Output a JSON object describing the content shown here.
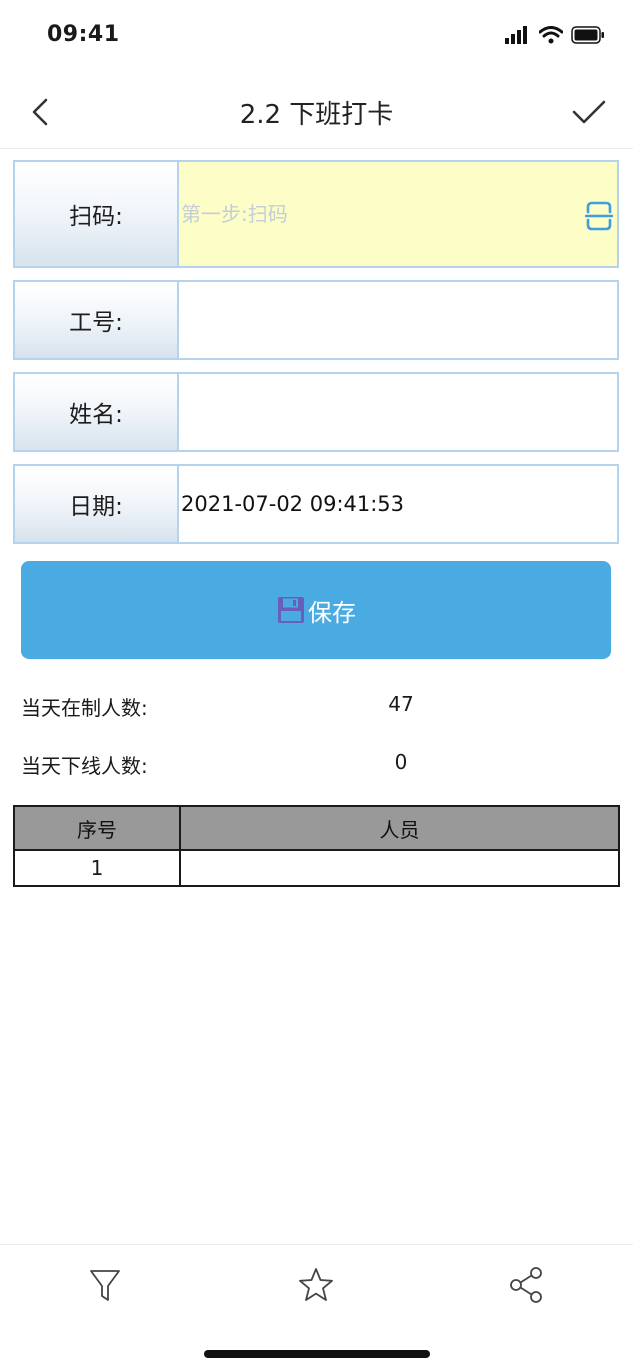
{
  "status_bar": {
    "time": "09:41"
  },
  "nav": {
    "title": "2.2 下班打卡"
  },
  "form": {
    "scan": {
      "label": "扫码:",
      "value": "",
      "placeholder": "第一步:扫码"
    },
    "employee_no": {
      "label": "工号:",
      "value": ""
    },
    "name": {
      "label": "姓名:",
      "value": ""
    },
    "date": {
      "label": "日期:",
      "value": "2021-07-02 09:41:53"
    }
  },
  "save_button": {
    "label": "保存"
  },
  "stats": {
    "on_duty": {
      "label": "当天在制人数:",
      "value": "47"
    },
    "off_line": {
      "label": "当天下线人数:",
      "value": "0"
    }
  },
  "table": {
    "headers": [
      "序号",
      "人员"
    ],
    "rows": [
      {
        "seq": "1",
        "person": ""
      }
    ]
  },
  "colors": {
    "accent": "#4aabe2",
    "field_border": "#b6d3ee",
    "scan_field_bg": "#fdfdc8",
    "table_header_bg": "#999999"
  },
  "icons": {
    "back": "chevron-left-icon",
    "confirm": "checkmark-icon",
    "scan": "scan-icon",
    "save": "floppy-disk-icon",
    "filter": "filter-icon",
    "favorite": "star-icon",
    "share": "share-icon"
  }
}
